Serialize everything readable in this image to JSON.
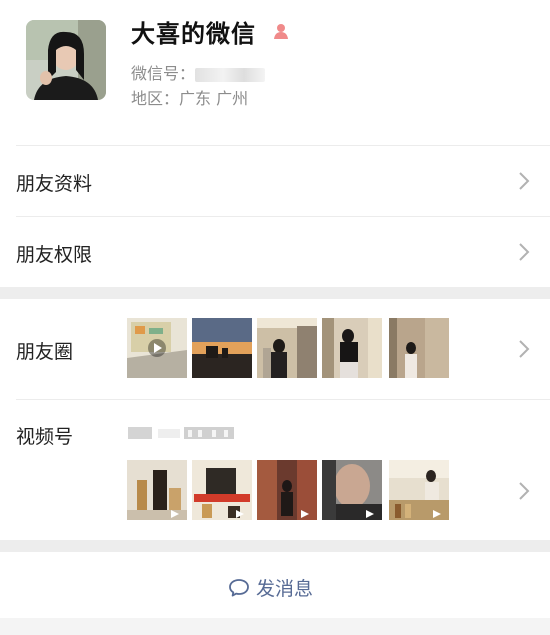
{
  "profile": {
    "name": "大喜的微信",
    "wechat_id_label": "微信号：",
    "wechat_id_value": "",
    "region_label": "地区：",
    "region_value": "广东 广州"
  },
  "menu": {
    "friend_info": "朋友资料",
    "friend_permissions": "朋友权限",
    "moments": "朋友圈",
    "channels": "视频号"
  },
  "actions": {
    "send_message": "发消息"
  },
  "colors": {
    "link": "#576b95",
    "separator": "#ededed",
    "gender_icon": "#f08a8a"
  }
}
